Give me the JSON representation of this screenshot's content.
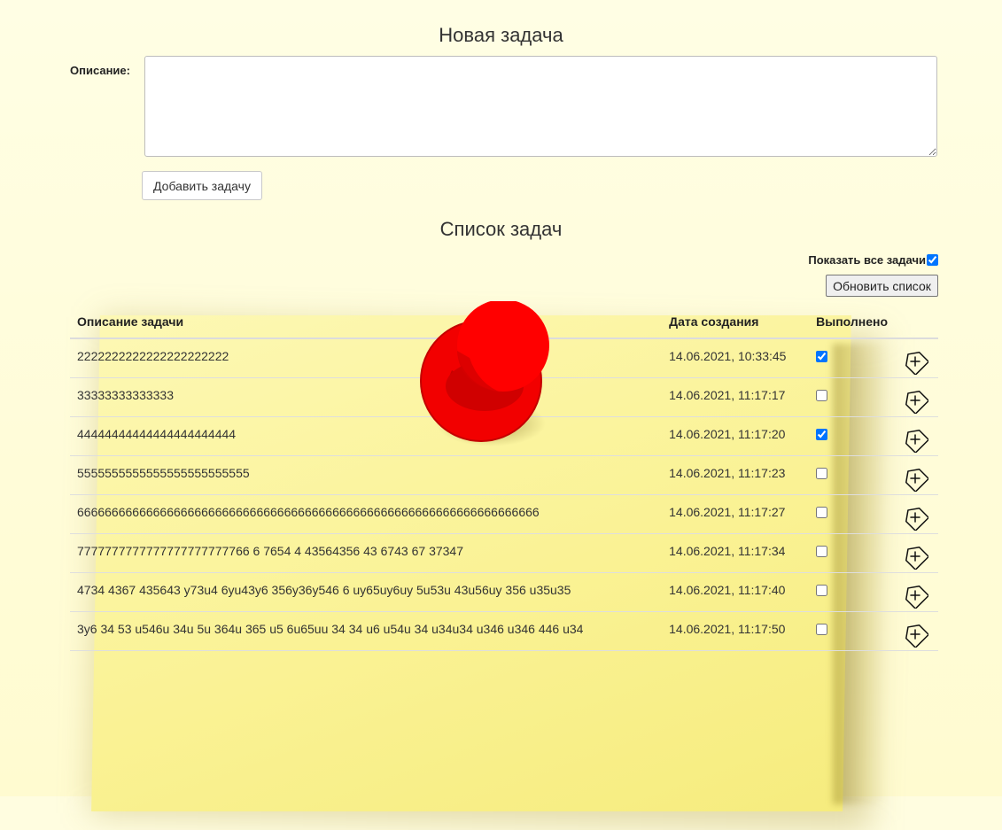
{
  "new_task": {
    "title": "Новая задача",
    "description_label": "Описание:",
    "description_value": "",
    "add_button_label": "Добавить задачу"
  },
  "task_list": {
    "title": "Список задач",
    "show_all_label": "Показать все задачи",
    "show_all_checked": true,
    "refresh_button_label": "Обновить список",
    "columns": {
      "description": "Описание задачи",
      "created": "Дата создания",
      "done": "Выполнено"
    },
    "rows": [
      {
        "description": "2222222222222222222222",
        "created": "14.06.2021, 10:33:45",
        "done": true
      },
      {
        "description": "33333333333333",
        "created": "14.06.2021, 11:17:17",
        "done": false
      },
      {
        "description": "44444444444444444444444",
        "created": "14.06.2021, 11:17:20",
        "done": true
      },
      {
        "description": "5555555555555555555555555",
        "created": "14.06.2021, 11:17:23",
        "done": false
      },
      {
        "description": "6666666666666666666666666666666666666666666666666666666666666666666",
        "created": "14.06.2021, 11:17:27",
        "done": false
      },
      {
        "description": "7777777777777777777777766 6 7654 4 43564356 43 6743 67 37347",
        "created": "14.06.2021, 11:17:34",
        "done": false
      },
      {
        "description": "4734 4367 435643 y73u4 6yu43y6 356y36y546 6 uy65uy6uy 5u53u 43u56uy 356 u35u35",
        "created": "14.06.2021, 11:17:40",
        "done": false
      },
      {
        "description": "3y6 34 53 u546u 34u 5u 364u 365 u5 6u65uu 34 34 u6 u54u 34 u34u34 u346 u346 446 u34",
        "created": "14.06.2021, 11:17:50",
        "done": false
      }
    ]
  },
  "icons": {
    "row_action": "tag-plus-icon",
    "decoration": "pushpin-icon"
  },
  "colors": {
    "page_background": "#fffde0",
    "sticky_note": "#faf294",
    "pushpin": "#ff0000",
    "checkbox_accent": "#0075ff"
  }
}
